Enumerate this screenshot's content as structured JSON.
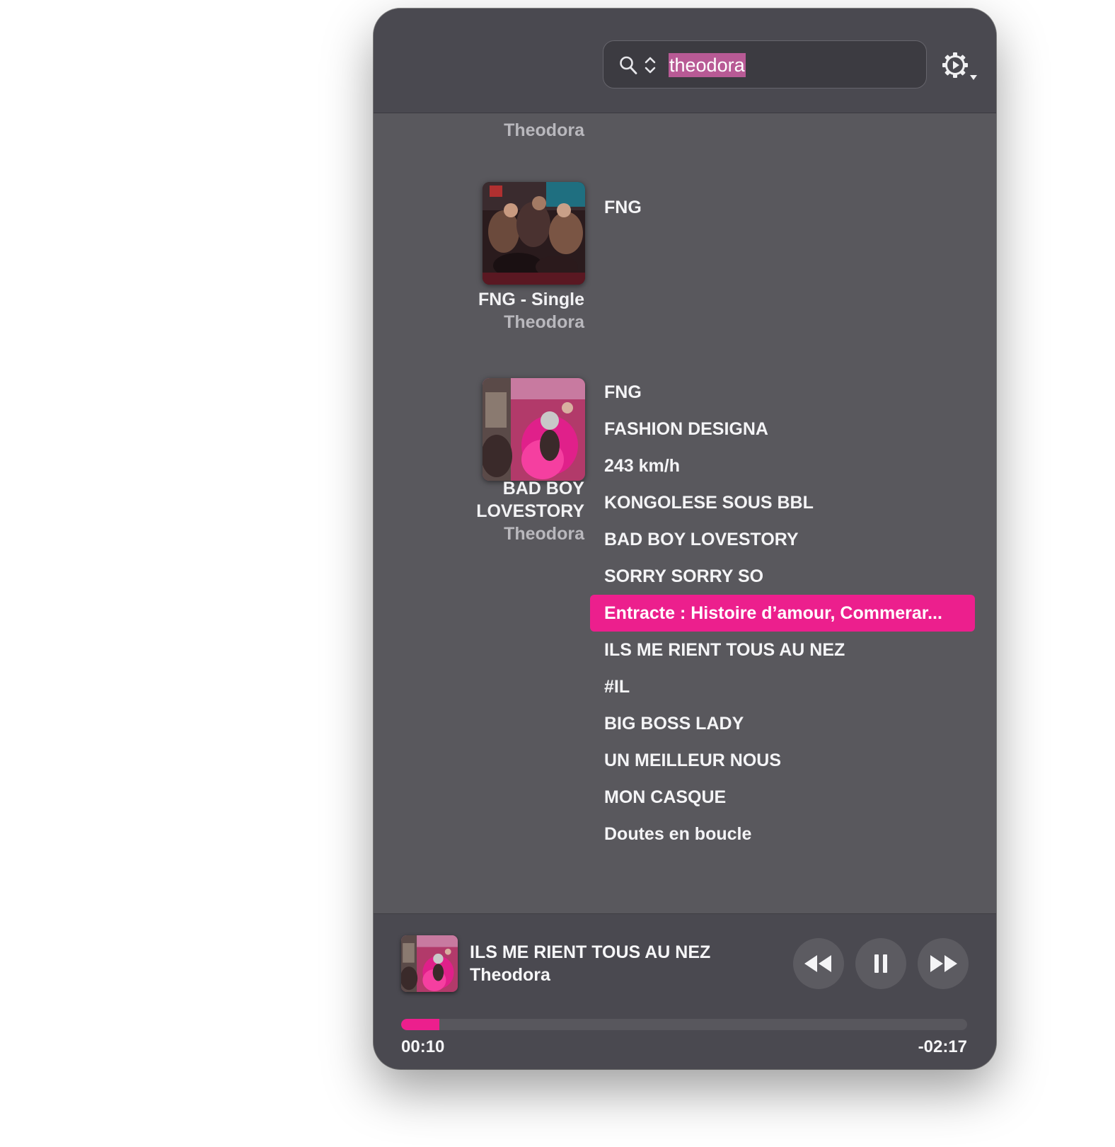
{
  "search": {
    "query": "theodora"
  },
  "icons": {
    "search": "magnifier-icon",
    "sort": "up-down-chevron-icon",
    "settings": "gear-with-dropdown-icon"
  },
  "albums": [
    {
      "artist": "Theodora",
      "tracks": []
    },
    {
      "title": "FNG - Single",
      "artist": "Theodora",
      "tracks": [
        "FNG"
      ]
    },
    {
      "title_lines": [
        "BAD BOY",
        "LOVESTORY"
      ],
      "artist": "Theodora",
      "tracks": [
        "FNG",
        "FASHION DESIGNA",
        "243 km/h",
        "KONGOLESE SOUS BBL",
        "BAD BOY LOVESTORY",
        "SORRY SORRY SO",
        "Entracte : Histoire d’amour, Commerar...",
        "ILS ME RIENT TOUS AU NEZ",
        "#IL",
        "BIG BOSS LADY",
        "UN MEILLEUR NOUS",
        "MON CASQUE",
        "Doutes en boucle"
      ],
      "selected_index": 6
    }
  ],
  "now_playing": {
    "title": "ILS ME RIENT TOUS AU NEZ",
    "artist": "Theodora",
    "elapsed": "00:10",
    "remaining": "-02:17",
    "progress_fraction": 0.068
  },
  "colors": {
    "accent": "#ec1f8d",
    "window_bg": "#59585d",
    "bar_bg": "#4a4950"
  }
}
